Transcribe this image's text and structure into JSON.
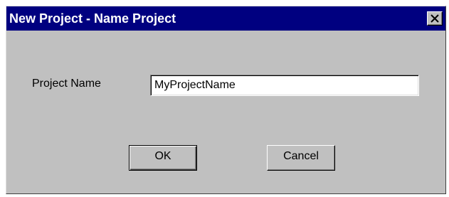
{
  "window": {
    "title": "New Project - Name Project",
    "title_bar_color": "#000080",
    "close_icon": "close-icon"
  },
  "form": {
    "project_name_label": "Project Name",
    "project_name_value": "MyProjectName"
  },
  "buttons": {
    "ok_label": "OK",
    "cancel_label": "Cancel"
  },
  "colors": {
    "dialog_background": "#c0c0c0",
    "title_text": "#ffffff"
  }
}
